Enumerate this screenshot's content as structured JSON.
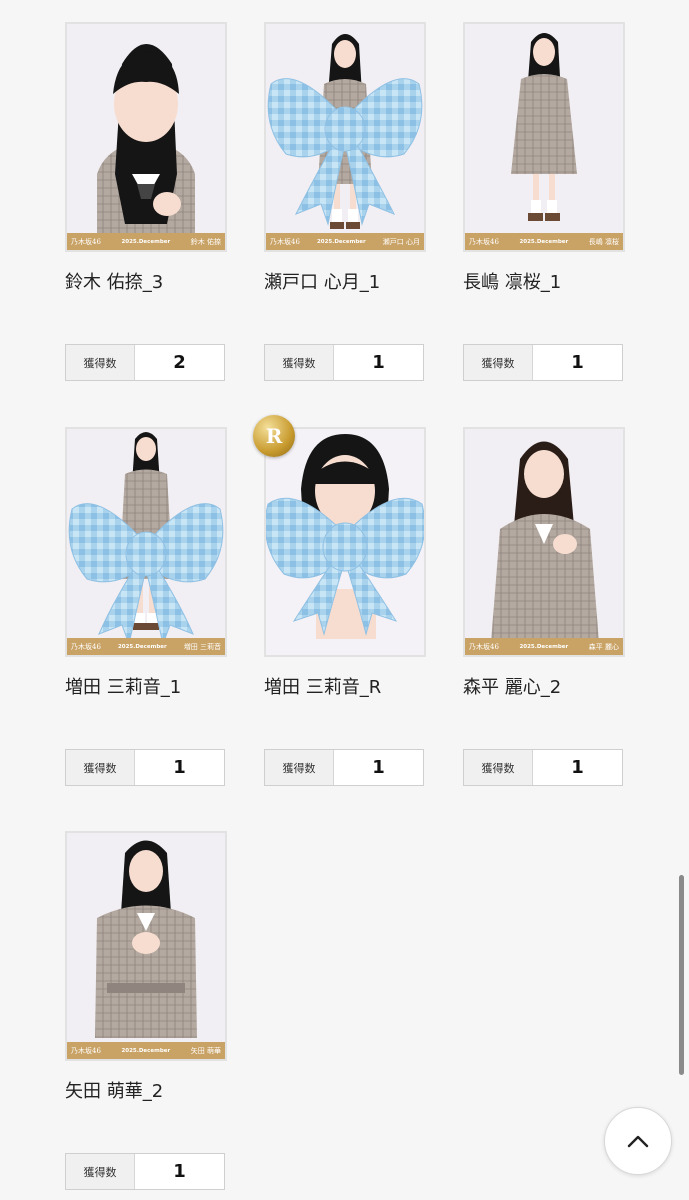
{
  "count_label": "獲得数",
  "strip": {
    "brand": "乃木坂46",
    "month": "2025.December"
  },
  "badge": {
    "label": "R",
    "icon": "gold-r-medal-icon"
  },
  "colors": {
    "strip_gold": "#c9a265",
    "ribbon_blue": "#a9d4ee",
    "uniform_beige": "#b4a9a0"
  },
  "cards": [
    {
      "title": "鈴木 佑捺_3",
      "strip_name": "鈴木 佑捺",
      "count": "2"
    },
    {
      "title": "瀬戸口 心月_1",
      "strip_name": "瀬戸口 心月",
      "count": "1"
    },
    {
      "title": "長嶋 凛桜_1",
      "strip_name": "長嶋 凛桜",
      "count": "1"
    },
    {
      "title": "増田 三莉音_1",
      "strip_name": "増田 三莉音",
      "count": "1"
    },
    {
      "title": "増田 三莉音_R",
      "strip_name": "",
      "count": "1"
    },
    {
      "title": "森平 麗心_2",
      "strip_name": "森平 麗心",
      "count": "1"
    },
    {
      "title": "矢田 萌華_2",
      "strip_name": "矢田 萌華",
      "count": "1"
    }
  ],
  "icons": {
    "scroll_top": "chevron-up-icon"
  }
}
